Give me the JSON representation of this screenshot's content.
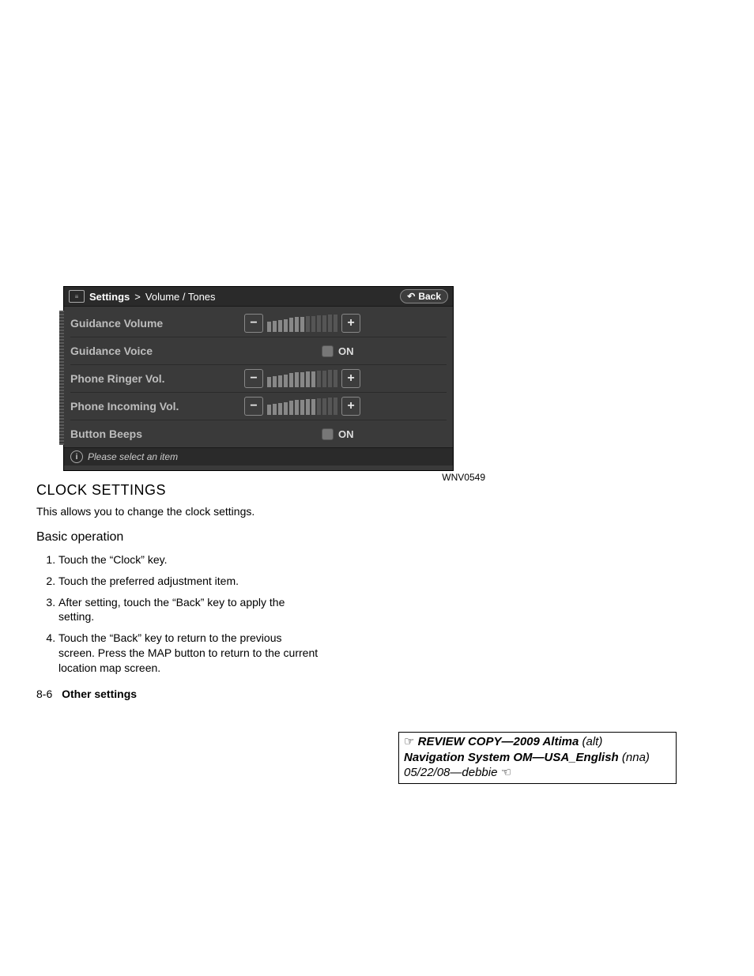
{
  "nav": {
    "breadcrumb_root": "Settings",
    "breadcrumb_sep": ">",
    "breadcrumb_leaf": "Volume / Tones",
    "back_label": "Back",
    "rows": {
      "guidance_volume": "Guidance Volume",
      "guidance_voice": "Guidance Voice",
      "phone_ringer": "Phone Ringer Vol.",
      "phone_incoming": "Phone Incoming Vol.",
      "button_beeps": "Button Beeps"
    },
    "on_label": "ON",
    "minus": "−",
    "plus": "+",
    "status": "Please select an item",
    "figure_code": "WNV0549"
  },
  "text": {
    "heading": "CLOCK SETTINGS",
    "intro": "This allows you to change the clock settings.",
    "sub": "Basic operation",
    "steps": [
      "Touch the “Clock” key.",
      "Touch the preferred adjustment item.",
      "After setting, touch the “Back” key to apply the setting.",
      "Touch the “Back” key to return to the previous screen. Press the MAP button to return to the current location map screen."
    ],
    "page_num": "8-6",
    "section_name": "Other settings"
  },
  "stamp": {
    "hand_left": "☞",
    "line1_bold": "REVIEW COPY—",
    "line1_ital": "2009 Altima",
    "line1_tail": " (alt)",
    "line2_bold": "Navigation System OM—USA_English",
    "line2_tail": " (nna)",
    "line3": "05/22/08—debbie",
    "hand_right": "☜"
  }
}
